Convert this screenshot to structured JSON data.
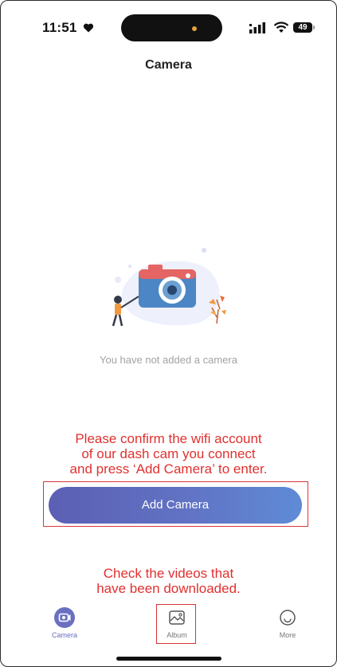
{
  "status_bar": {
    "time": "11:51",
    "battery": "49"
  },
  "nav": {
    "title": "Camera"
  },
  "empty_state": {
    "message": "You have not added a camera"
  },
  "annotations": {
    "top": [
      "Please confirm the wifi account",
      "of our dash cam you connect",
      "and press ‘Add Camera’ to enter."
    ],
    "bottom": [
      "Check the videos that",
      "have been downloaded."
    ]
  },
  "add_button": {
    "label": "Add Camera"
  },
  "tabs": [
    {
      "label": "Camera",
      "icon": "camera-icon",
      "active": true
    },
    {
      "label": "Album",
      "icon": "album-icon",
      "active": false
    },
    {
      "label": "More",
      "icon": "more-icon",
      "active": false
    }
  ],
  "colors": {
    "accent": "#6a6fc0",
    "annotation": "#e0312f"
  }
}
